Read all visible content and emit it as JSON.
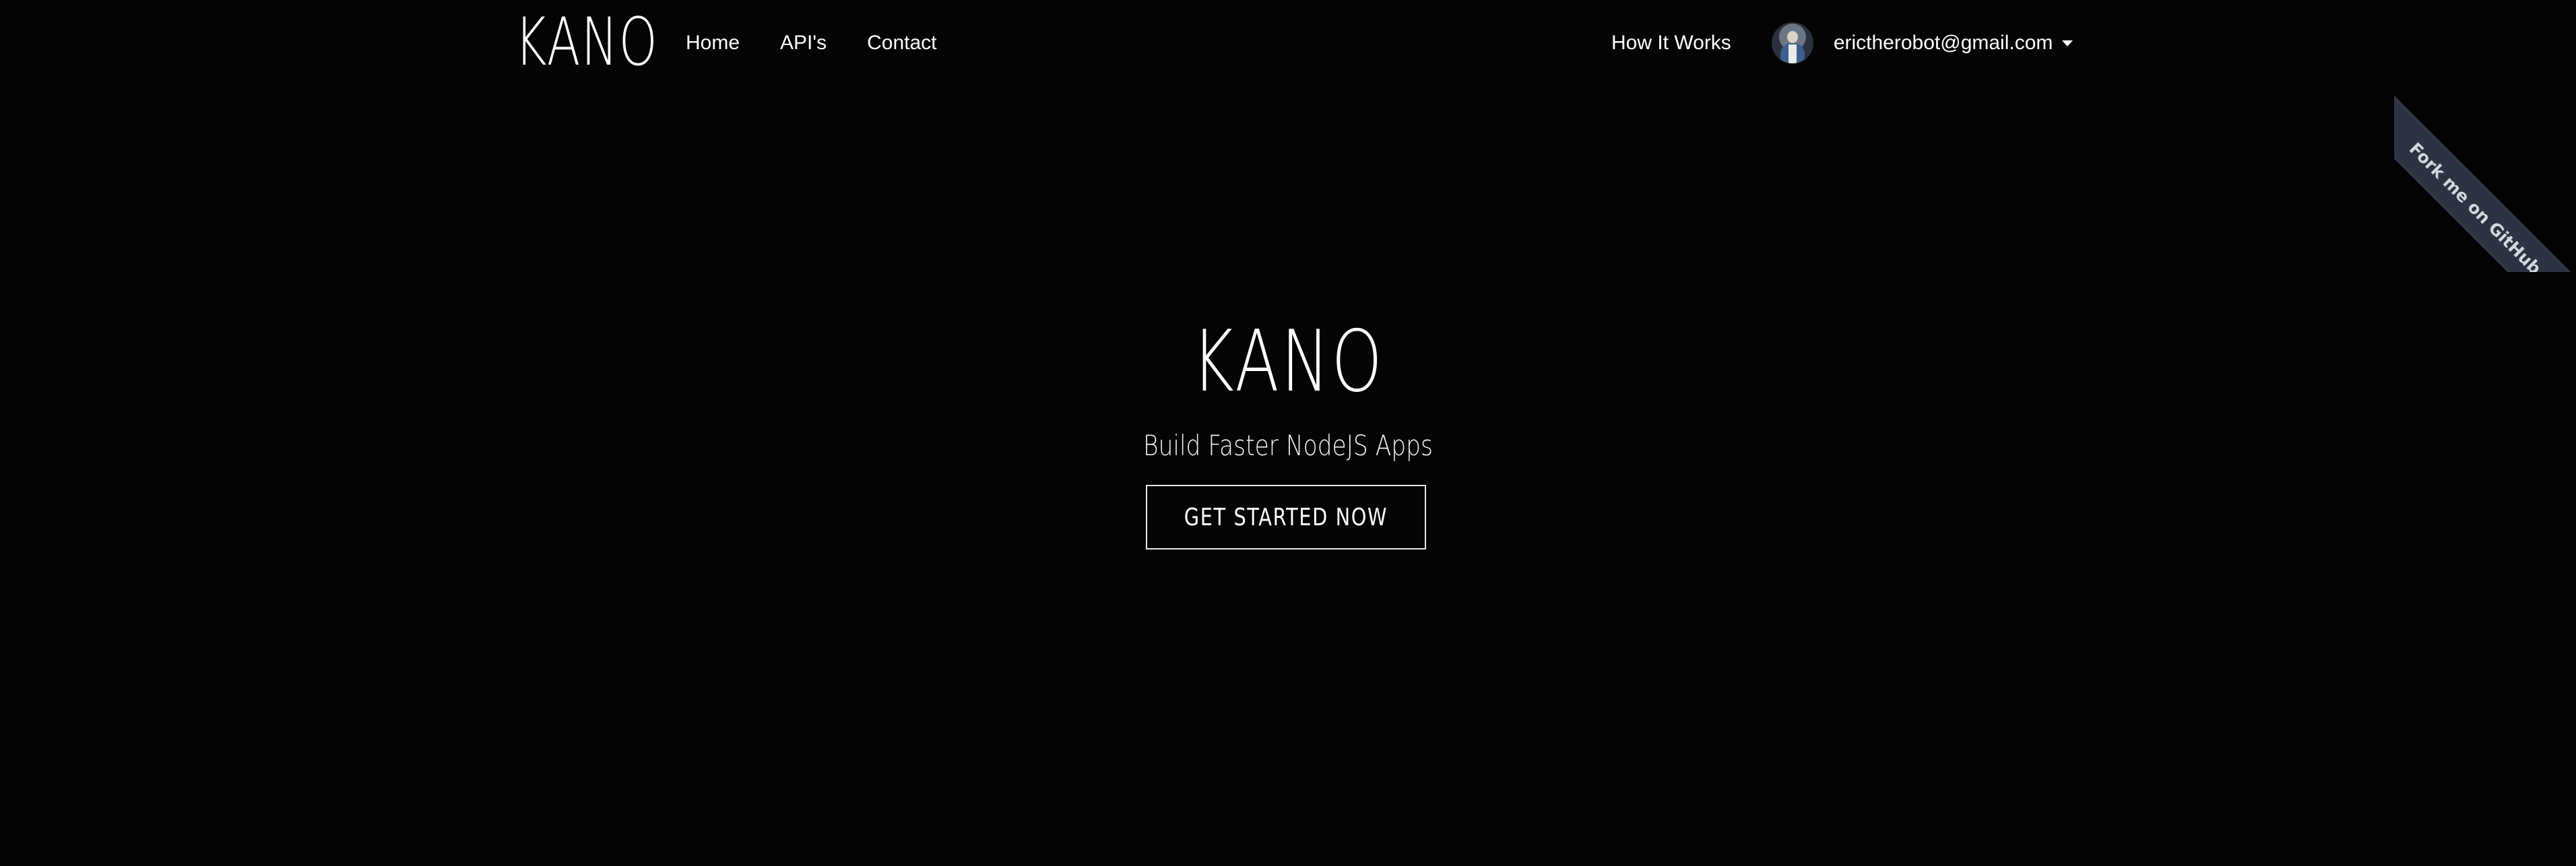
{
  "navbar": {
    "brand": "KANO",
    "links": [
      "Home",
      "API's",
      "Contact"
    ],
    "how_it_works": "How It Works",
    "user": {
      "email": "erictherobot@gmail.com"
    }
  },
  "ribbon": {
    "label": "Fork me on GitHub"
  },
  "hero": {
    "title": "KANO",
    "subtitle": "Build Faster NodeJS Apps",
    "cta_label": "GET STARTED NOW"
  },
  "colors": {
    "background": "#040404",
    "text": "#ffffff",
    "ribbon": "#2c3442"
  }
}
